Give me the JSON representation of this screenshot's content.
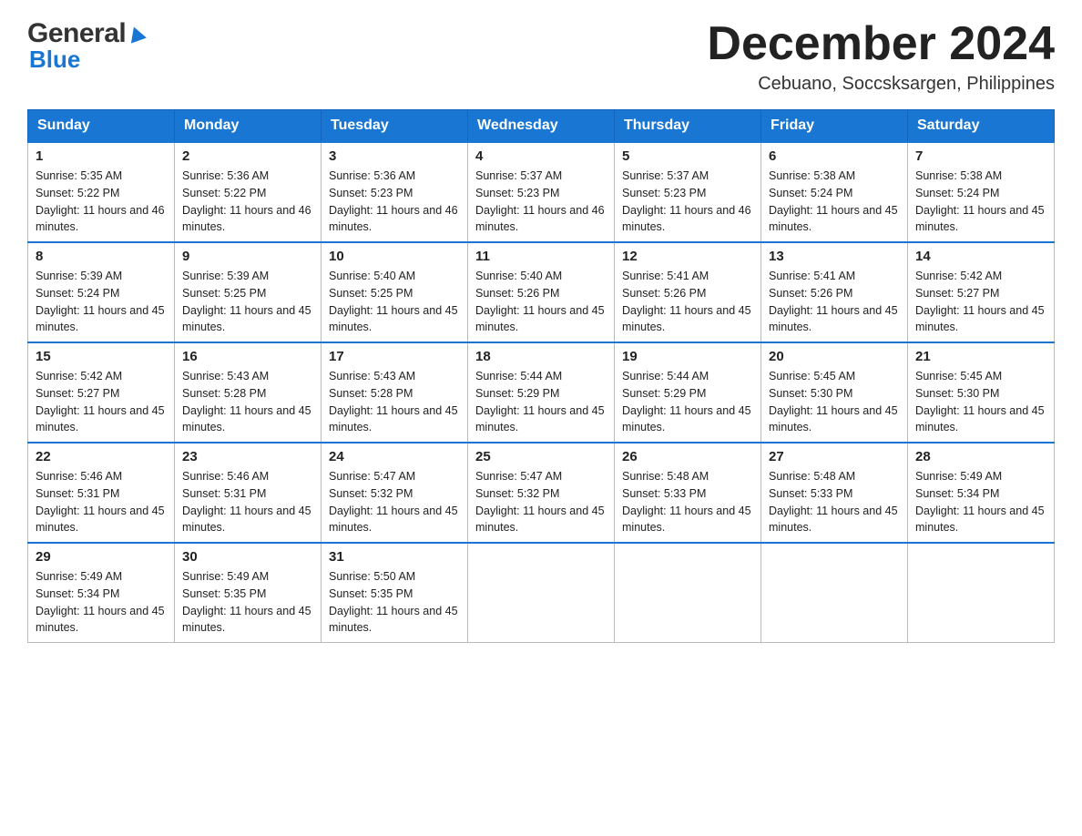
{
  "header": {
    "logo_general": "General",
    "logo_blue": "Blue",
    "month_title": "December 2024",
    "subtitle": "Cebuano, Soccsksargen, Philippines"
  },
  "days": [
    "Sunday",
    "Monday",
    "Tuesday",
    "Wednesday",
    "Thursday",
    "Friday",
    "Saturday"
  ],
  "weeks": [
    [
      {
        "date": "1",
        "sunrise": "5:35 AM",
        "sunset": "5:22 PM",
        "daylight": "11 hours and 46 minutes."
      },
      {
        "date": "2",
        "sunrise": "5:36 AM",
        "sunset": "5:22 PM",
        "daylight": "11 hours and 46 minutes."
      },
      {
        "date": "3",
        "sunrise": "5:36 AM",
        "sunset": "5:23 PM",
        "daylight": "11 hours and 46 minutes."
      },
      {
        "date": "4",
        "sunrise": "5:37 AM",
        "sunset": "5:23 PM",
        "daylight": "11 hours and 46 minutes."
      },
      {
        "date": "5",
        "sunrise": "5:37 AM",
        "sunset": "5:23 PM",
        "daylight": "11 hours and 46 minutes."
      },
      {
        "date": "6",
        "sunrise": "5:38 AM",
        "sunset": "5:24 PM",
        "daylight": "11 hours and 45 minutes."
      },
      {
        "date": "7",
        "sunrise": "5:38 AM",
        "sunset": "5:24 PM",
        "daylight": "11 hours and 45 minutes."
      }
    ],
    [
      {
        "date": "8",
        "sunrise": "5:39 AM",
        "sunset": "5:24 PM",
        "daylight": "11 hours and 45 minutes."
      },
      {
        "date": "9",
        "sunrise": "5:39 AM",
        "sunset": "5:25 PM",
        "daylight": "11 hours and 45 minutes."
      },
      {
        "date": "10",
        "sunrise": "5:40 AM",
        "sunset": "5:25 PM",
        "daylight": "11 hours and 45 minutes."
      },
      {
        "date": "11",
        "sunrise": "5:40 AM",
        "sunset": "5:26 PM",
        "daylight": "11 hours and 45 minutes."
      },
      {
        "date": "12",
        "sunrise": "5:41 AM",
        "sunset": "5:26 PM",
        "daylight": "11 hours and 45 minutes."
      },
      {
        "date": "13",
        "sunrise": "5:41 AM",
        "sunset": "5:26 PM",
        "daylight": "11 hours and 45 minutes."
      },
      {
        "date": "14",
        "sunrise": "5:42 AM",
        "sunset": "5:27 PM",
        "daylight": "11 hours and 45 minutes."
      }
    ],
    [
      {
        "date": "15",
        "sunrise": "5:42 AM",
        "sunset": "5:27 PM",
        "daylight": "11 hours and 45 minutes."
      },
      {
        "date": "16",
        "sunrise": "5:43 AM",
        "sunset": "5:28 PM",
        "daylight": "11 hours and 45 minutes."
      },
      {
        "date": "17",
        "sunrise": "5:43 AM",
        "sunset": "5:28 PM",
        "daylight": "11 hours and 45 minutes."
      },
      {
        "date": "18",
        "sunrise": "5:44 AM",
        "sunset": "5:29 PM",
        "daylight": "11 hours and 45 minutes."
      },
      {
        "date": "19",
        "sunrise": "5:44 AM",
        "sunset": "5:29 PM",
        "daylight": "11 hours and 45 minutes."
      },
      {
        "date": "20",
        "sunrise": "5:45 AM",
        "sunset": "5:30 PM",
        "daylight": "11 hours and 45 minutes."
      },
      {
        "date": "21",
        "sunrise": "5:45 AM",
        "sunset": "5:30 PM",
        "daylight": "11 hours and 45 minutes."
      }
    ],
    [
      {
        "date": "22",
        "sunrise": "5:46 AM",
        "sunset": "5:31 PM",
        "daylight": "11 hours and 45 minutes."
      },
      {
        "date": "23",
        "sunrise": "5:46 AM",
        "sunset": "5:31 PM",
        "daylight": "11 hours and 45 minutes."
      },
      {
        "date": "24",
        "sunrise": "5:47 AM",
        "sunset": "5:32 PM",
        "daylight": "11 hours and 45 minutes."
      },
      {
        "date": "25",
        "sunrise": "5:47 AM",
        "sunset": "5:32 PM",
        "daylight": "11 hours and 45 minutes."
      },
      {
        "date": "26",
        "sunrise": "5:48 AM",
        "sunset": "5:33 PM",
        "daylight": "11 hours and 45 minutes."
      },
      {
        "date": "27",
        "sunrise": "5:48 AM",
        "sunset": "5:33 PM",
        "daylight": "11 hours and 45 minutes."
      },
      {
        "date": "28",
        "sunrise": "5:49 AM",
        "sunset": "5:34 PM",
        "daylight": "11 hours and 45 minutes."
      }
    ],
    [
      {
        "date": "29",
        "sunrise": "5:49 AM",
        "sunset": "5:34 PM",
        "daylight": "11 hours and 45 minutes."
      },
      {
        "date": "30",
        "sunrise": "5:49 AM",
        "sunset": "5:35 PM",
        "daylight": "11 hours and 45 minutes."
      },
      {
        "date": "31",
        "sunrise": "5:50 AM",
        "sunset": "5:35 PM",
        "daylight": "11 hours and 45 minutes."
      },
      null,
      null,
      null,
      null
    ]
  ]
}
